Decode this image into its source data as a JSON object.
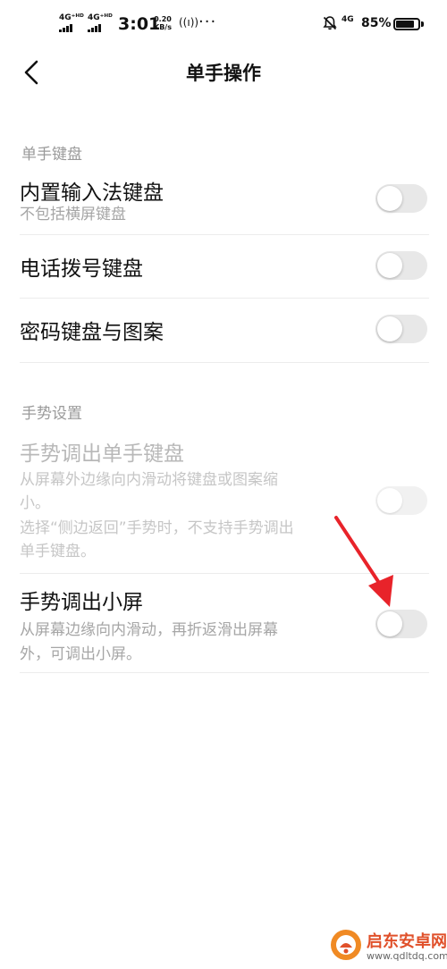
{
  "status_bar": {
    "network_1": "4G⁺ᴴᴰ",
    "network_2": "4G⁺ᴴᴰ",
    "time": "3:01",
    "speed_value": "0.20",
    "speed_unit": "KB/s",
    "hotspot": "((ı))",
    "more": "···",
    "mobile_data": "4G",
    "battery_percent": "85%",
    "battery_level": 0.85
  },
  "header": {
    "title": "单手操作"
  },
  "sections": {
    "keyboard": {
      "header": "单手键盘",
      "builtin_ime": {
        "title": "内置输入法键盘",
        "subtitle": "不包括横屏键盘"
      },
      "dialer": {
        "title": "电话拨号键盘"
      },
      "password": {
        "title": "密码键盘与图案"
      }
    },
    "gesture": {
      "header": "手势设置",
      "gesture_keyboard": {
        "title": "手势调出单手键盘",
        "subtitle_line1": "从屏幕外边缘向内滑动将键盘或图案缩",
        "subtitle_line2": "小。",
        "subtitle_line3": "选择“侧边返回”手势时，不支持手势调出",
        "subtitle_line4": "单手键盘。"
      },
      "gesture_small_screen": {
        "title": "手势调出小屏",
        "subtitle_line1": "从屏幕边缘向内滑动，再折返滑出屏幕",
        "subtitle_line2": "外，可调出小屏。"
      }
    }
  },
  "watermark": {
    "name": "启东安卓网",
    "url": "www.qdltdq.com"
  },
  "colors": {
    "annotation_arrow": "#e8232a",
    "watermark_brand": "#e0502a"
  }
}
